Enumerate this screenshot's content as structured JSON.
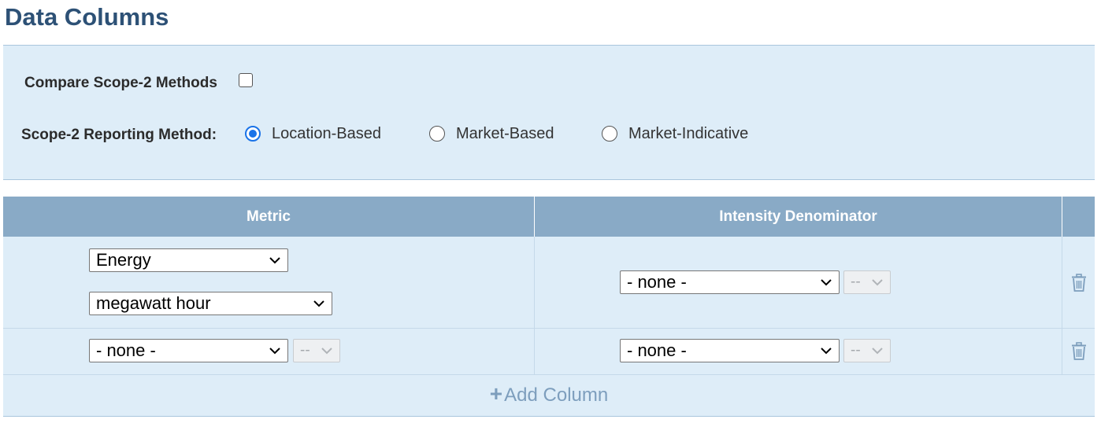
{
  "page": {
    "title": "Data Columns"
  },
  "options": {
    "compare_label": "Compare Scope-2 Methods",
    "compare_checked": false,
    "reporting_label": "Scope-2 Reporting Method:",
    "methods": [
      {
        "label": "Location-Based",
        "selected": true
      },
      {
        "label": "Market-Based",
        "selected": false
      },
      {
        "label": "Market-Indicative",
        "selected": false
      }
    ]
  },
  "table": {
    "headers": [
      "Metric",
      "Intensity Denominator"
    ],
    "rows": [
      {
        "metric": "Energy",
        "unit": "megawatt hour",
        "denominator": "- none -",
        "denominator_unit": "--"
      },
      {
        "metric": "- none -",
        "metric_unit": "--",
        "denominator": "- none -",
        "denominator_unit": "--"
      }
    ],
    "add_column_label": "Add Column"
  },
  "colors": {
    "title": "#2d5176",
    "panel_bg": "#deedf8",
    "header_bg": "#89aac6",
    "radio_accent": "#1a73e8",
    "link": "#7d9ebd"
  },
  "icons": {
    "dropdown": "chevron-down-icon",
    "delete": "trash-icon",
    "add": "plus-icon"
  }
}
